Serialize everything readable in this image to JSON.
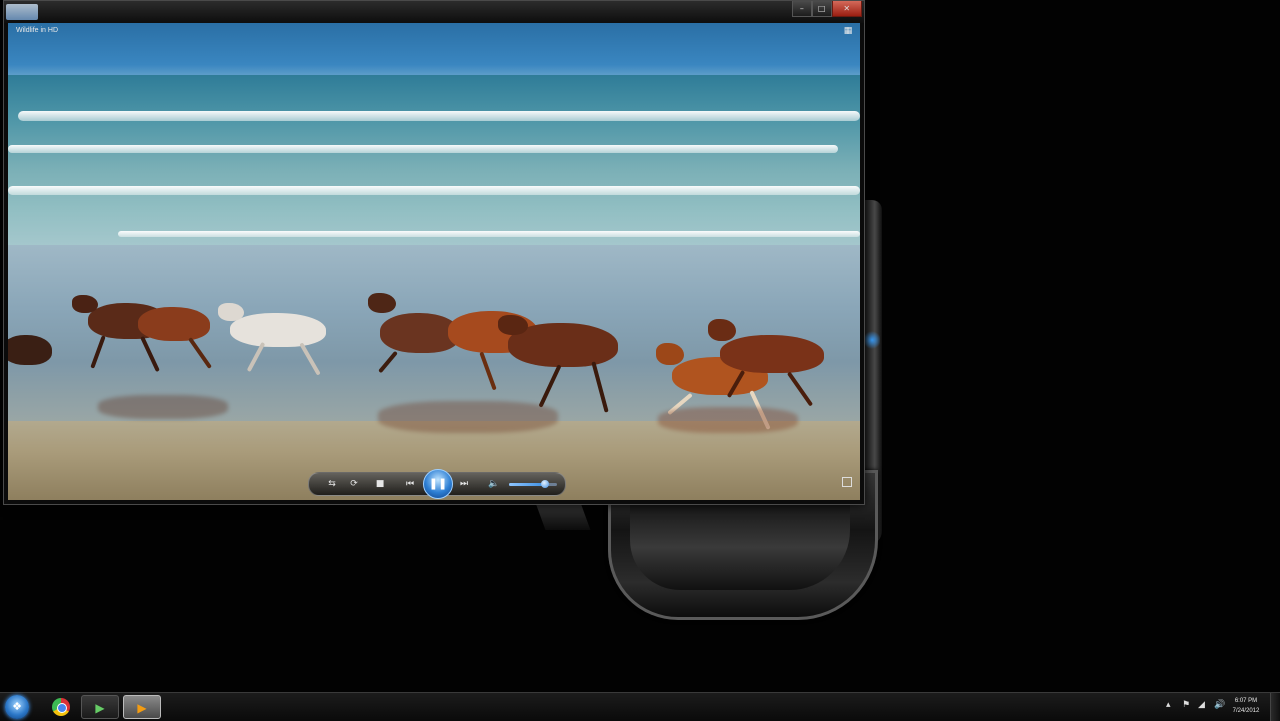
{
  "player": {
    "video_title": "Wildlife in HD",
    "playback_state": "playing",
    "volume_fraction": 0.75,
    "controls": {
      "shuffle_icon": "shuffle-icon",
      "repeat_icon": "repeat-icon",
      "stop_icon": "stop-icon",
      "previous_icon": "previous-icon",
      "play_pause_icon": "pause-icon",
      "next_icon": "next-icon",
      "mute_icon": "speaker-icon",
      "fullscreen_icon": "fullscreen-icon",
      "switch_library_icon": "switch-to-library-icon"
    },
    "accent_color": "#2d7fd4"
  },
  "window_controls": {
    "minimize_icon": "minimize-icon",
    "maximize_icon": "maximize-icon",
    "close_icon": "close-icon"
  },
  "taskbar": {
    "start_icon": "windows-start-icon",
    "pinned": [
      {
        "name": "chrome",
        "icon": "chrome-icon"
      },
      {
        "name": "media-center",
        "icon": "media-center-icon"
      },
      {
        "name": "media-player",
        "icon": "media-player-icon",
        "active": true
      }
    ],
    "tray_icons": [
      "show-hidden-icons-icon",
      "flag-icon",
      "network-icon",
      "volume-icon"
    ],
    "clock": {
      "time": "6:07 PM",
      "date": "7/24/2012"
    }
  }
}
